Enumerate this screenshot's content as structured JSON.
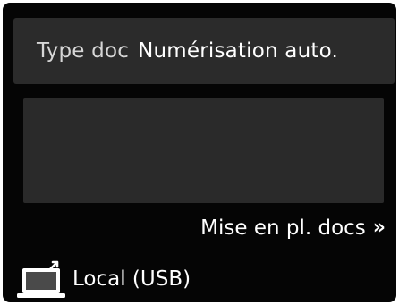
{
  "type_doc": {
    "label": "Type doc",
    "value": "Numérisation auto."
  },
  "placement": {
    "label": "Mise en pl. docs",
    "icon": "double-chevron-right-icon"
  },
  "destination": {
    "label": "Local (USB)",
    "icon": "computer-usb-icon"
  },
  "colors": {
    "screen_background": "#050505",
    "panel_background": "#2b2b2b",
    "text_primary": "#ffffff",
    "text_secondary": "#d6d6d6"
  }
}
